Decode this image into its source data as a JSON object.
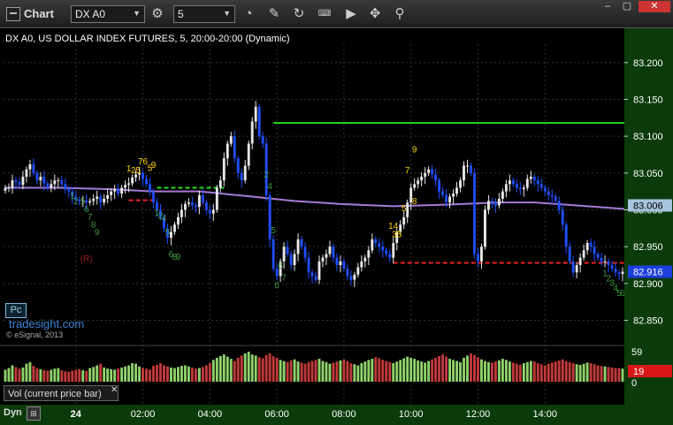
{
  "app": {
    "title": "Chart"
  },
  "toolbar": {
    "symbol": "DX A0",
    "interval": "5",
    "icons": [
      "settings-gear-icon",
      "history-clock-icon",
      "pencil-draw-icon",
      "refresh-icon",
      "keyboard-icon",
      "play-icon",
      "move-tool-icon"
    ]
  },
  "window_controls": [
    "minimize",
    "maximize",
    "close"
  ],
  "instrument_title": "DX A0, US DOLLAR INDEX FUTURES, 5, 20:00-20:00 (Dynamic)",
  "watermark": "tradesight.com",
  "copyright": "© eSignal, 2013",
  "pc_button": "Pc",
  "volume_panel": {
    "label": "Vol (current price bar)",
    "close": "✕",
    "ticks": [
      "59",
      "0"
    ],
    "current": "19"
  },
  "footer": {
    "dyn": "Dyn",
    "dyn_icon": "fit-icon"
  },
  "colors": {
    "up": "#e8e8e8",
    "down": "#1f4fff",
    "ma": "#a67ad6",
    "green_level": "#22dd22",
    "red_level": "#ee2222",
    "axis_text": "#ffffff",
    "vol_up": "#8fd36a",
    "vol_down": "#c23a3a"
  },
  "chart_data": {
    "type": "candlestick",
    "y_ticks": [
      "83.200",
      "83.150",
      "83.100",
      "83.050",
      "83.000",
      "82.950",
      "82.900",
      "82.850"
    ],
    "ylim": [
      82.835,
      83.225
    ],
    "x_ticks": [
      "24",
      "02:00",
      "04:00",
      "06:00",
      "08:00",
      "10:00",
      "12:00",
      "14:00"
    ],
    "price_labels": [
      {
        "value": "83.006",
        "bg": "#a7c4dd",
        "fg": "#000000"
      },
      {
        "value": "82.916",
        "bg": "#1c3fe0",
        "fg": "#ffffff"
      }
    ],
    "moving_average_points": [
      [
        0,
        83.03
      ],
      [
        15,
        83.03
      ],
      [
        30,
        83.028
      ],
      [
        42,
        83.025
      ],
      [
        55,
        83.025
      ],
      [
        70,
        83.018
      ],
      [
        82,
        83.012
      ],
      [
        95,
        83.008
      ],
      [
        110,
        83.005
      ],
      [
        125,
        83.007
      ],
      [
        140,
        83.01
      ],
      [
        150,
        83.01
      ],
      [
        162,
        83.006
      ],
      [
        176,
        83.001
      ]
    ],
    "levels": [
      {
        "color": "#22dd22",
        "from": 76,
        "to": 176,
        "y": 83.118
      },
      {
        "color": "#22dd22",
        "from": 43,
        "to": 62,
        "y": 83.03,
        "dashed": true
      },
      {
        "color": "#ee2222",
        "from": 35,
        "to": 43,
        "y": 83.013,
        "dashed": true
      },
      {
        "color": "#ee2222",
        "from": 110,
        "to": 176,
        "y": 82.928,
        "dashed": true
      }
    ],
    "annotations": [
      {
        "text": "76",
        "bar": 39,
        "y": 83.062,
        "color": "#ffd700"
      },
      {
        "text": "9",
        "bar": 42,
        "y": 83.057,
        "color": "#ffd700"
      },
      {
        "text": "5",
        "bar": 41,
        "y": 83.053,
        "color": "#ffd700"
      },
      {
        "text": "1",
        "bar": 35,
        "y": 83.052,
        "color": "#ffd700"
      },
      {
        "text": "25",
        "bar": 37,
        "y": 83.05,
        "color": "#ffd700"
      },
      {
        "text": "9",
        "bar": 116,
        "y": 83.078,
        "color": "#ffd700"
      },
      {
        "text": "7",
        "bar": 114,
        "y": 83.05,
        "color": "#ffd700"
      },
      {
        "text": "8",
        "bar": 116,
        "y": 83.008,
        "color": "#ffd700"
      },
      {
        "text": "5",
        "bar": 113,
        "y": 82.998,
        "color": "#ffd700"
      },
      {
        "text": "14",
        "bar": 110,
        "y": 82.974,
        "color": "#ffd700"
      },
      {
        "text": "35",
        "bar": 111,
        "y": 82.963,
        "color": "#ffd700"
      },
      {
        "text": "1",
        "bar": 19,
        "y": 83.015,
        "color": "#3c9a3c"
      },
      {
        "text": "2",
        "bar": 20,
        "y": 83.008,
        "color": "#3c9a3c"
      },
      {
        "text": "5",
        "bar": 22,
        "y": 83.008,
        "color": "#3c9a3c"
      },
      {
        "text": "6",
        "bar": 23,
        "y": 82.997,
        "color": "#3c9a3c"
      },
      {
        "text": "7",
        "bar": 24,
        "y": 82.986,
        "color": "#3c9a3c"
      },
      {
        "text": "8",
        "bar": 25,
        "y": 82.976,
        "color": "#3c9a3c"
      },
      {
        "text": "9",
        "bar": 26,
        "y": 82.966,
        "color": "#3c9a3c"
      },
      {
        "text": "(R)",
        "bar": 23,
        "y": 82.93,
        "color": "#a01818"
      },
      {
        "text": "1",
        "bar": 43,
        "y": 82.992,
        "color": "#3c9a3c"
      },
      {
        "text": "2",
        "bar": 44,
        "y": 82.988,
        "color": "#3c9a3c"
      },
      {
        "text": "4",
        "bar": 45,
        "y": 82.985,
        "color": "#3c9a3c"
      },
      {
        "text": "5",
        "bar": 46,
        "y": 82.966,
        "color": "#3c9a3c"
      },
      {
        "text": "6",
        "bar": 47,
        "y": 82.936,
        "color": "#3c9a3c"
      },
      {
        "text": "8",
        "bar": 48,
        "y": 82.932,
        "color": "#3c9a3c"
      },
      {
        "text": "9",
        "bar": 49,
        "y": 82.932,
        "color": "#3c9a3c"
      },
      {
        "text": "2",
        "bar": 74,
        "y": 83.044,
        "color": "#3c9a3c"
      },
      {
        "text": "4",
        "bar": 75,
        "y": 83.028,
        "color": "#3c9a3c"
      },
      {
        "text": "5",
        "bar": 76,
        "y": 82.968,
        "color": "#3c9a3c"
      },
      {
        "text": "6",
        "bar": 78,
        "y": 82.92,
        "color": "#3c9a3c"
      },
      {
        "text": "7",
        "bar": 79,
        "y": 82.904,
        "color": "#3c9a3c"
      },
      {
        "text": "6",
        "bar": 77,
        "y": 82.894,
        "color": "#3c9a3c"
      },
      {
        "text": "1",
        "bar": 170,
        "y": 82.91,
        "color": "#3c9a3c"
      },
      {
        "text": "2",
        "bar": 171,
        "y": 82.903,
        "color": "#3c9a3c"
      },
      {
        "text": "3",
        "bar": 172,
        "y": 82.897,
        "color": "#3c9a3c"
      },
      {
        "text": "4",
        "bar": 173,
        "y": 82.89,
        "color": "#3c9a3c"
      },
      {
        "text": "5",
        "bar": 174,
        "y": 82.883,
        "color": "#3c9a3c"
      },
      {
        "text": "6",
        "bar": 175,
        "y": 82.883,
        "color": "#3c9a3c"
      }
    ],
    "closes": [
      83.03,
      83.03,
      83.04,
      83.038,
      83.034,
      83.045,
      83.055,
      83.062,
      83.05,
      83.04,
      83.045,
      83.036,
      83.03,
      83.035,
      83.04,
      83.04,
      83.035,
      83.028,
      83.025,
      83.018,
      83.014,
      83.012,
      83.013,
      83.01,
      83.012,
      83.015,
      83.018,
      83.01,
      83.015,
      83.02,
      83.025,
      83.028,
      83.022,
      83.03,
      83.034,
      83.036,
      83.044,
      83.048,
      83.05,
      83.042,
      83.035,
      83.025,
      83.01,
      83.0,
      82.99,
      82.975,
      82.962,
      82.97,
      82.98,
      82.99,
      83.0,
      83.008,
      83.01,
      83.006,
      83.004,
      83.02,
      83.01,
      83.0,
      82.995,
      83.0,
      83.03,
      83.04,
      83.07,
      83.09,
      83.1,
      83.07,
      83.05,
      83.04,
      83.06,
      83.09,
      83.12,
      83.14,
      83.1,
      83.09,
      83.02,
      82.96,
      82.92,
      82.91,
      82.93,
      82.95,
      82.94,
      82.925,
      82.94,
      82.96,
      82.95,
      82.935,
      82.915,
      82.91,
      82.905,
      82.93,
      82.935,
      82.94,
      82.95,
      82.935,
      82.925,
      82.93,
      82.92,
      82.91,
      82.905,
      82.912,
      82.922,
      82.93,
      82.935,
      82.945,
      82.96,
      82.955,
      82.95,
      82.945,
      82.94,
      82.935,
      82.955,
      82.97,
      82.98,
      82.99,
      83.01,
      83.03,
      83.035,
      83.04,
      83.045,
      83.05,
      83.055,
      83.048,
      83.04,
      83.025,
      83.02,
      83.01,
      83.018,
      83.022,
      83.03,
      83.04,
      83.06,
      83.06,
      83.05,
      82.94,
      82.93,
      82.95,
      83.0,
      83.012,
      83.01,
      83.006,
      83.015,
      83.025,
      83.035,
      83.04,
      83.035,
      83.03,
      83.028,
      83.03,
      83.042,
      83.045,
      83.04,
      83.035,
      83.03,
      83.025,
      83.02,
      83.018,
      83.012,
      83.0,
      82.98,
      82.95,
      82.93,
      82.915,
      82.925,
      82.935,
      82.945,
      82.955,
      82.95,
      82.94,
      82.935,
      82.93,
      82.93,
      82.925,
      82.92,
      82.915,
      82.913,
      82.916
    ],
    "volumes": [
      22,
      25,
      30,
      27,
      24,
      26,
      33,
      36,
      29,
      25,
      23,
      21,
      20,
      22,
      24,
      25,
      21,
      19,
      18,
      20,
      22,
      23,
      21,
      20,
      25,
      27,
      30,
      33,
      26,
      24,
      23,
      22,
      24,
      26,
      28,
      30,
      34,
      33,
      28,
      25,
      24,
      22,
      29,
      31,
      34,
      30,
      28,
      26,
      25,
      27,
      29,
      30,
      28,
      26,
      24,
      25,
      27,
      30,
      34,
      40,
      44,
      47,
      50,
      46,
      42,
      38,
      44,
      48,
      52,
      55,
      50,
      48,
      45,
      43,
      49,
      52,
      47,
      44,
      40,
      38,
      36,
      39,
      41,
      37,
      35,
      33,
      36,
      38,
      40,
      42,
      38,
      36,
      33,
      35,
      37,
      39,
      41,
      38,
      34,
      32,
      30,
      34,
      37,
      40,
      42,
      45,
      43,
      40,
      38,
      36,
      34,
      37,
      40,
      43,
      46,
      44,
      42,
      39,
      37,
      35,
      38,
      41,
      44,
      47,
      50,
      46,
      42,
      40,
      38,
      36,
      44,
      48,
      52,
      49,
      45,
      41,
      38,
      36,
      35,
      37,
      39,
      42,
      40,
      37,
      35,
      33,
      31,
      34,
      36,
      38,
      37,
      34,
      32,
      30,
      33,
      35,
      37,
      39,
      41,
      38,
      36,
      34,
      32,
      31,
      33,
      35,
      34,
      32,
      30,
      29,
      28,
      27,
      26,
      25,
      25,
      24,
      23,
      22
    ]
  }
}
